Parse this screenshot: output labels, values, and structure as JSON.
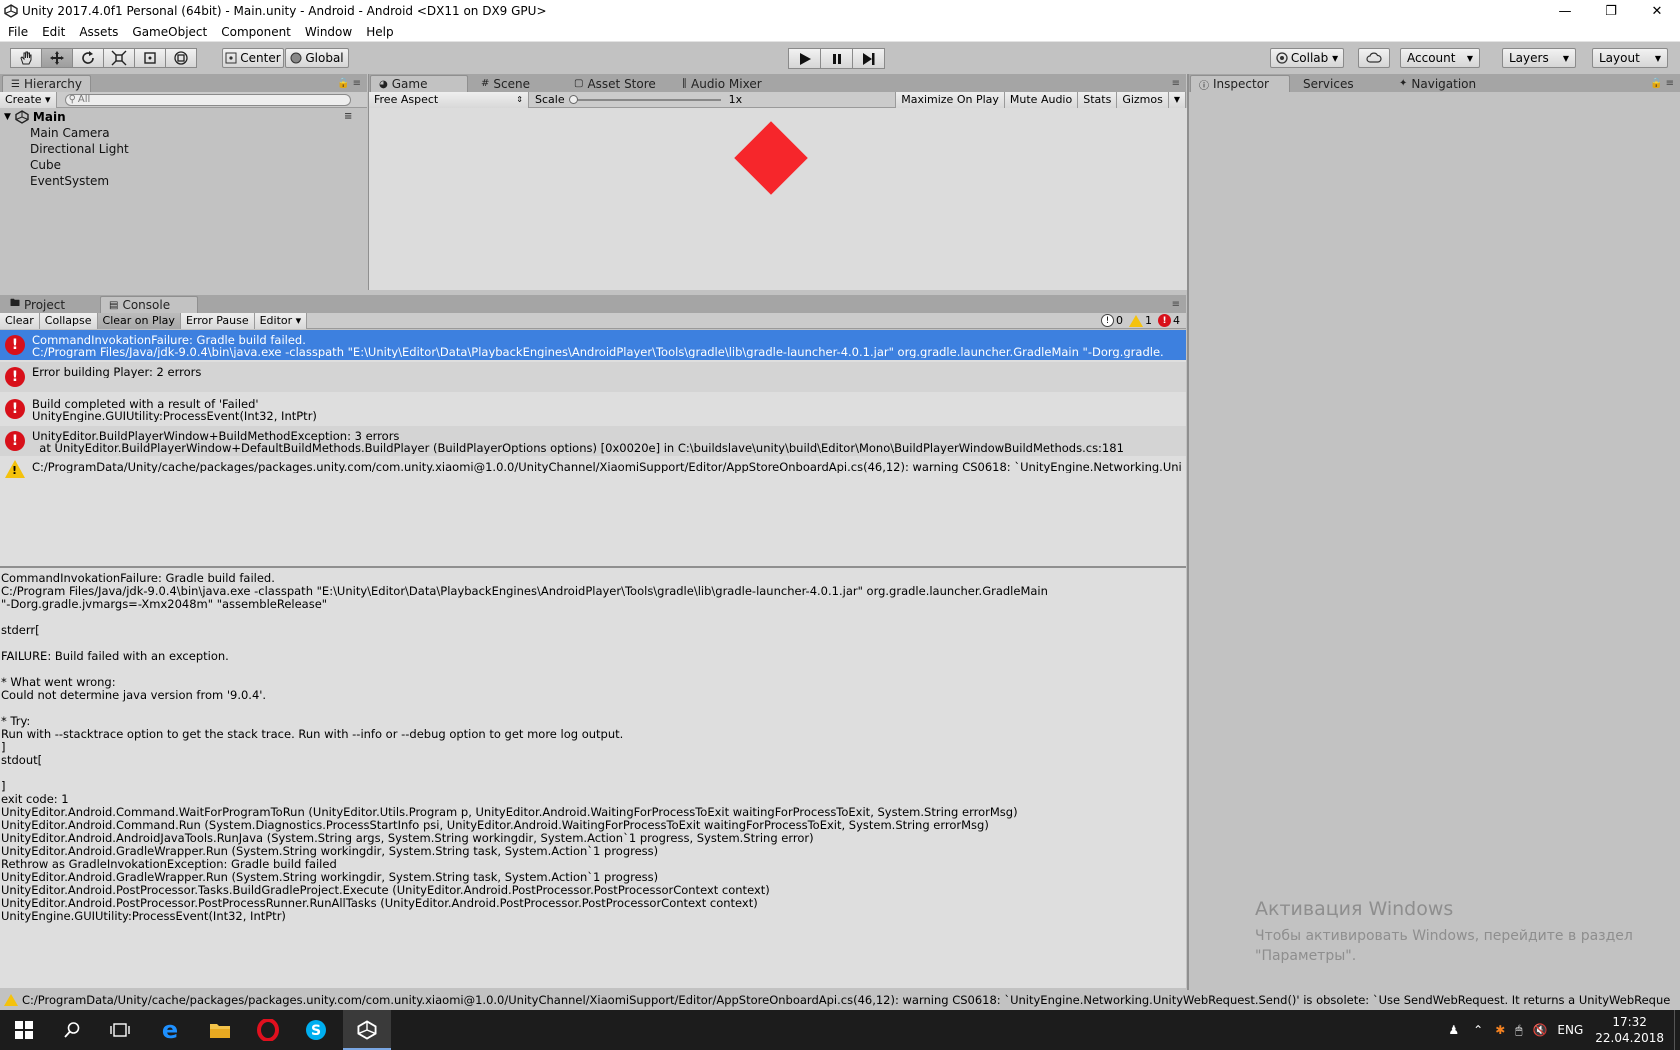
{
  "window": {
    "title": "Unity 2017.4.0f1 Personal (64bit) - Main.unity - Android - Android <DX11 on DX9 GPU>"
  },
  "menu": [
    "File",
    "Edit",
    "Assets",
    "GameObject",
    "Component",
    "Window",
    "Help"
  ],
  "toolbar": {
    "pivot_label": "Center",
    "space_label": "Global",
    "collab_label": "Collab ▾",
    "account_label": "Account",
    "layers_label": "Layers",
    "layout_label": "Layout"
  },
  "hierarchy": {
    "tab": "Hierarchy",
    "create_label": "Create ▾",
    "search_placeholder": "All",
    "scene": "Main",
    "items": [
      "Main Camera",
      "Directional Light",
      "Cube",
      "EventSystem"
    ]
  },
  "view_tabs": [
    "Game",
    "Scene",
    "Asset Store",
    "Audio Mixer"
  ],
  "game": {
    "aspect": "Free Aspect",
    "scale_label": "Scale",
    "scale_value": "1x",
    "buttons": [
      "Maximize On Play",
      "Mute Audio",
      "Stats",
      "Gizmos"
    ]
  },
  "right_tabs": [
    "Inspector",
    "Services",
    "Navigation"
  ],
  "bottom_tabs": [
    "Project",
    "Console"
  ],
  "console": {
    "buttons": [
      "Clear",
      "Collapse",
      "Clear on Play",
      "Error Pause",
      "Editor ▾"
    ],
    "counts": {
      "info": "0",
      "warn": "1",
      "error": "4"
    },
    "entries": [
      {
        "type": "error",
        "line1": "CommandInvokationFailure: Gradle build failed.",
        "line2": "C:/Program Files/Java/jdk-9.0.4\\bin\\java.exe -classpath \"E:\\Unity\\Editor\\Data\\PlaybackEngines\\AndroidPlayer\\Tools\\gradle\\lib\\gradle-launcher-4.0.1.jar\" org.gradle.launcher.GradleMain \"-Dorg.gradle."
      },
      {
        "type": "error",
        "line1": "Error building Player: 2 errors",
        "line2": ""
      },
      {
        "type": "error",
        "line1": "Build completed with a result of 'Failed'",
        "line2": "UnityEngine.GUIUtility:ProcessEvent(Int32, IntPtr)"
      },
      {
        "type": "error",
        "line1": "UnityEditor.BuildPlayerWindow+BuildMethodException: 3 errors",
        "line2": "  at UnityEditor.BuildPlayerWindow+DefaultBuildMethods.BuildPlayer (BuildPlayerOptions options) [0x0020e] in C:\\buildslave\\unity\\build\\Editor\\Mono\\BuildPlayerWindowBuildMethods.cs:181"
      },
      {
        "type": "warning",
        "line1": "C:/ProgramData/Unity/cache/packages/packages.unity.com/com.unity.xiaomi@1.0.0/UnityChannel/XiaomiSupport/Editor/AppStoreOnboardApi.cs(46,12): warning CS0618: `UnityEngine.Networking.Uni",
        "line2": ""
      }
    ],
    "detail": "CommandInvokationFailure: Gradle build failed.\nC:/Program Files/Java/jdk-9.0.4\\bin\\java.exe -classpath \"E:\\Unity\\Editor\\Data\\PlaybackEngines\\AndroidPlayer\\Tools\\gradle\\lib\\gradle-launcher-4.0.1.jar\" org.gradle.launcher.GradleMain\n\"-Dorg.gradle.jvmargs=-Xmx2048m\" \"assembleRelease\"\n\nstderr[\n\nFAILURE: Build failed with an exception.\n\n* What went wrong:\nCould not determine java version from '9.0.4'.\n\n* Try:\nRun with --stacktrace option to get the stack trace. Run with --info or --debug option to get more log output.\n]\nstdout[\n\n]\nexit code: 1\nUnityEditor.Android.Command.WaitForProgramToRun (UnityEditor.Utils.Program p, UnityEditor.Android.WaitingForProcessToExit waitingForProcessToExit, System.String errorMsg)\nUnityEditor.Android.Command.Run (System.Diagnostics.ProcessStartInfo psi, UnityEditor.Android.WaitingForProcessToExit waitingForProcessToExit, System.String errorMsg)\nUnityEditor.Android.AndroidJavaTools.RunJava (System.String args, System.String workingdir, System.Action`1 progress, System.String error)\nUnityEditor.Android.GradleWrapper.Run (System.String workingdir, System.String task, System.Action`1 progress)\nRethrow as GradleInvokationException: Gradle build failed\nUnityEditor.Android.GradleWrapper.Run (System.String workingdir, System.String task, System.Action`1 progress)\nUnityEditor.Android.PostProcessor.Tasks.BuildGradleProject.Execute (UnityEditor.Android.PostProcessor.PostProcessorContext context)\nUnityEditor.Android.PostProcessor.PostProcessRunner.RunAllTasks (UnityEditor.Android.PostProcessor.PostProcessorContext context)\nUnityEngine.GUIUtility:ProcessEvent(Int32, IntPtr)"
  },
  "status": {
    "text": "C:/ProgramData/Unity/cache/packages/packages.unity.com/com.unity.xiaomi@1.0.0/UnityChannel/XiaomiSupport/Editor/AppStoreOnboardApi.cs(46,12): warning CS0618: `UnityEngine.Networking.UnityWebRequest.Send()' is obsolete: `Use SendWebRequest.  It returns a UnityWebReque"
  },
  "activation": {
    "title": "Активация Windows",
    "body": "Чтобы активировать Windows, перейдите в раздел\n\"Параметры\"."
  },
  "taskbar": {
    "lang": "ENG",
    "time": "17:32",
    "date": "22.04.2018"
  },
  "colors": {
    "cube": "#f6262b",
    "selection": "#3d80df",
    "error": "#d8101a",
    "warning": "#f4c20d"
  }
}
